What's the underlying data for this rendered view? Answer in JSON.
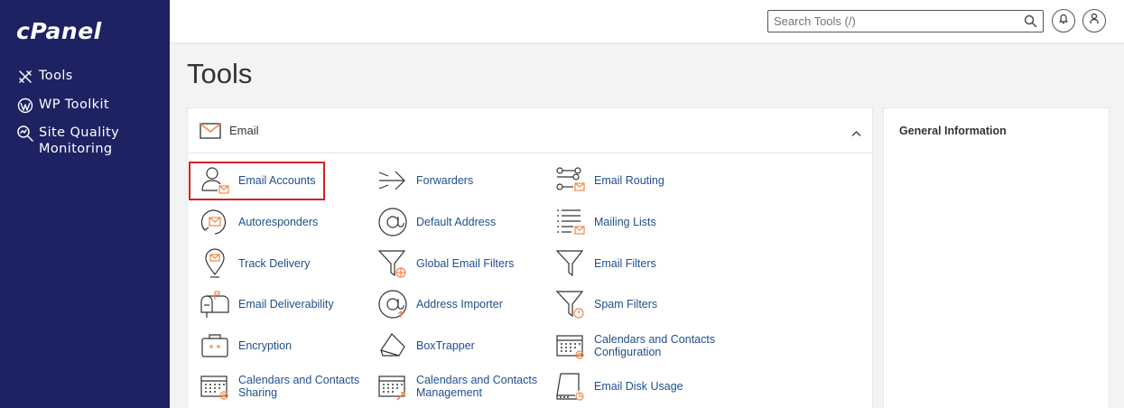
{
  "brand": {
    "logo": "cPanel"
  },
  "sidebar": {
    "items": [
      {
        "label": "Tools",
        "icon": "tools-icon"
      },
      {
        "label": "WP Toolkit",
        "icon": "wordpress-icon"
      },
      {
        "label": "Site Quality Monitoring",
        "icon": "search-chart-icon"
      }
    ]
  },
  "header": {
    "search_placeholder": "Search Tools (/)",
    "notifications_icon": "bell-icon",
    "user_icon": "user-icon"
  },
  "page": {
    "title": "Tools"
  },
  "email_panel": {
    "title": "Email",
    "tools": [
      {
        "label": "Email Accounts",
        "icon": "email-accounts-icon",
        "highlighted": true
      },
      {
        "label": "Forwarders",
        "icon": "forwarders-icon"
      },
      {
        "label": "Email Routing",
        "icon": "email-routing-icon"
      },
      {
        "label": "Autoresponders",
        "icon": "autoresponders-icon"
      },
      {
        "label": "Default Address",
        "icon": "at-sign-icon"
      },
      {
        "label": "Mailing Lists",
        "icon": "mailing-lists-icon"
      },
      {
        "label": "Track Delivery",
        "icon": "location-pin-icon"
      },
      {
        "label": "Global Email Filters",
        "icon": "funnel-globe-icon"
      },
      {
        "label": "Email Filters",
        "icon": "funnel-icon"
      },
      {
        "label": "Email Deliverability",
        "icon": "mailbox-icon"
      },
      {
        "label": "Address Importer",
        "icon": "at-upload-icon"
      },
      {
        "label": "Spam Filters",
        "icon": "funnel-warning-icon"
      },
      {
        "label": "Encryption",
        "icon": "briefcase-lock-icon"
      },
      {
        "label": "BoxTrapper",
        "icon": "box-trap-icon"
      },
      {
        "label": "Calendars and Contacts Configuration",
        "icon": "calendar-config-icon"
      },
      {
        "label": "Calendars and Contacts Sharing",
        "icon": "calendar-share-icon"
      },
      {
        "label": "Calendars and Contacts Management",
        "icon": "calendar-manage-icon"
      },
      {
        "label": "Email Disk Usage",
        "icon": "disk-usage-icon"
      }
    ]
  },
  "info_panel": {
    "title": "General Information"
  },
  "colors": {
    "sidebar_bg": "#1d2262",
    "link": "#1d4f8c",
    "accent": "#f0874a",
    "highlight_border": "#d52121"
  }
}
